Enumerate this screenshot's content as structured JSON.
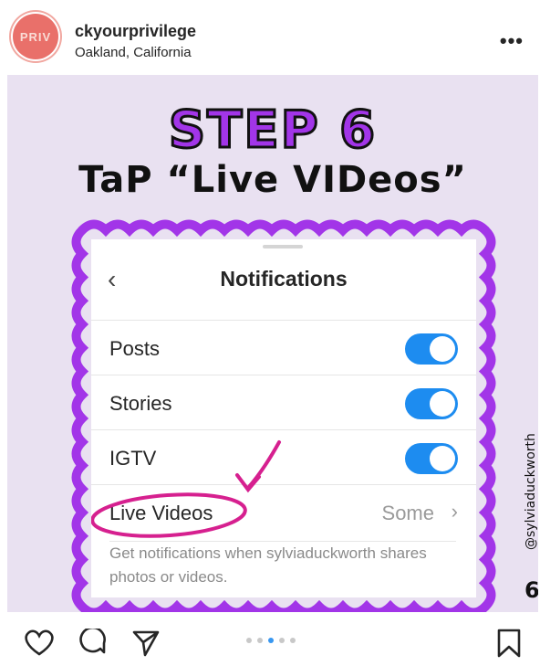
{
  "header": {
    "avatar_text": "PRIV",
    "username": "ckyourprivilege",
    "location": "Oakland, California",
    "more": "•••"
  },
  "post": {
    "step": "STEP 6",
    "instruction": "TaP “Live VIDeos”",
    "credit": "@sylviaduckworth",
    "page_number": "6",
    "frame_color": "#a235e8",
    "background_color": "#e9e1f1",
    "screen": {
      "back": "‹",
      "title": "Notifications",
      "rows": [
        {
          "label": "Posts",
          "toggle_on": true
        },
        {
          "label": "Stories",
          "toggle_on": true
        },
        {
          "label": "IGTV",
          "toggle_on": true
        },
        {
          "label": "Live Videos",
          "value": "Some",
          "chevron": "›"
        }
      ],
      "footnote": "Get notifications when sylviaduckworth shares photos or videos.",
      "toggle_color": "#1d8cf0"
    }
  },
  "actions": {
    "icons": [
      "heart-icon",
      "comment-icon",
      "share-icon",
      "bookmark-icon"
    ],
    "carousel_count": 5,
    "carousel_active": 2,
    "accent": "#3897f0"
  }
}
